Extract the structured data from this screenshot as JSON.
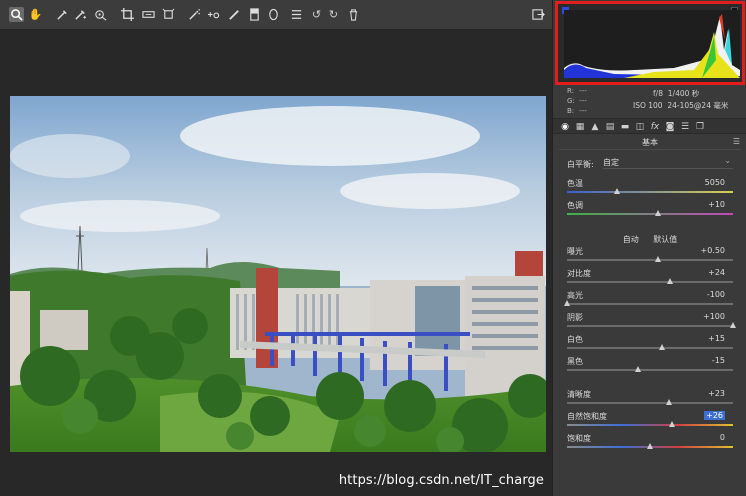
{
  "toolbar": {
    "tools": [
      {
        "name": "zoom-tool",
        "icon": "magnifier-icon",
        "glyph": "⌕"
      },
      {
        "name": "hand-tool",
        "icon": "hand-icon",
        "glyph": "✋"
      },
      {
        "name": "white-balance-tool",
        "icon": "eyedropper-icon",
        "glyph": "✎"
      },
      {
        "name": "color-sampler-tool",
        "icon": "eyedropper-plus-icon",
        "glyph": "✎"
      },
      {
        "name": "targeted-adjustment-tool",
        "icon": "target-icon",
        "glyph": "◎"
      },
      {
        "name": "crop-tool",
        "icon": "crop-icon",
        "glyph": "⌗"
      },
      {
        "name": "straighten-tool",
        "icon": "level-icon",
        "glyph": "▭"
      },
      {
        "name": "transform-tool",
        "icon": "transform-icon",
        "glyph": "⊡"
      },
      {
        "name": "spot-removal-tool",
        "icon": "spot-removal-icon",
        "glyph": "⁂"
      },
      {
        "name": "red-eye-tool",
        "icon": "red-eye-icon",
        "glyph": "⊙"
      },
      {
        "name": "adjustment-brush-tool",
        "icon": "brush-icon",
        "glyph": "/"
      },
      {
        "name": "graduated-filter-tool",
        "icon": "graduated-filter-icon",
        "glyph": "▤"
      },
      {
        "name": "radial-filter-tool",
        "icon": "radial-filter-icon",
        "glyph": "○"
      },
      {
        "name": "preferences-tool",
        "icon": "list-icon",
        "glyph": "☰"
      },
      {
        "name": "rotate-left-tool",
        "icon": "rotate-left-icon",
        "glyph": "↺"
      },
      {
        "name": "rotate-right-tool",
        "icon": "rotate-right-icon",
        "glyph": "↻"
      },
      {
        "name": "delete-tool",
        "icon": "trash-icon",
        "glyph": "🗑"
      }
    ],
    "fullscreen_glyph": "⇥"
  },
  "info": {
    "r_label": "R:",
    "r_value": "---",
    "g_label": "G:",
    "g_value": "---",
    "b_label": "B:",
    "b_value": "---",
    "aperture": "f/8",
    "shutter": "1/400 秒",
    "iso": "ISO 100",
    "lens": "24-105@24 毫米"
  },
  "panel_tabs": [
    {
      "name": "tab-basic",
      "glyph": "◉"
    },
    {
      "name": "tab-tone-curve",
      "glyph": "▦"
    },
    {
      "name": "tab-detail",
      "glyph": "▲"
    },
    {
      "name": "tab-hsl",
      "glyph": "▤"
    },
    {
      "name": "tab-split-toning",
      "glyph": "▬"
    },
    {
      "name": "tab-lens",
      "glyph": "◫"
    },
    {
      "name": "tab-effects",
      "glyph": "fx"
    },
    {
      "name": "tab-camera-calibration",
      "glyph": "◙"
    },
    {
      "name": "tab-presets",
      "glyph": "☰"
    },
    {
      "name": "tab-snapshots",
      "glyph": "❐"
    }
  ],
  "basic": {
    "title": "基本",
    "menu_glyph": "☰",
    "wb_label": "白平衡:",
    "wb_value": "自定",
    "auto_label": "自动",
    "default_label": "默认值",
    "sliders": [
      {
        "key": "temperature",
        "label": "色温",
        "value": "5050",
        "pos": 0.3
      },
      {
        "key": "tint",
        "label": "色调",
        "value": "+10",
        "pos": 0.55
      },
      {
        "key": "exposure",
        "label": "曝光",
        "value": "+0.50",
        "pos": 0.55
      },
      {
        "key": "contrast",
        "label": "对比度",
        "value": "+24",
        "pos": 0.62
      },
      {
        "key": "highlights",
        "label": "高光",
        "value": "-100",
        "pos": 0.0
      },
      {
        "key": "shadows",
        "label": "阴影",
        "value": "+100",
        "pos": 1.0
      },
      {
        "key": "whites",
        "label": "白色",
        "value": "+15",
        "pos": 0.575
      },
      {
        "key": "blacks",
        "label": "黑色",
        "value": "-15",
        "pos": 0.425
      },
      {
        "key": "clarity",
        "label": "清晰度",
        "value": "+23",
        "pos": 0.615
      },
      {
        "key": "vibrance",
        "label": "自然饱和度",
        "value": "+26",
        "pos": 0.63,
        "highlight": true
      },
      {
        "key": "saturation",
        "label": "饱和度",
        "value": "0",
        "pos": 0.5
      }
    ]
  },
  "watermark": "https://blog.csdn.net/IT_charge"
}
